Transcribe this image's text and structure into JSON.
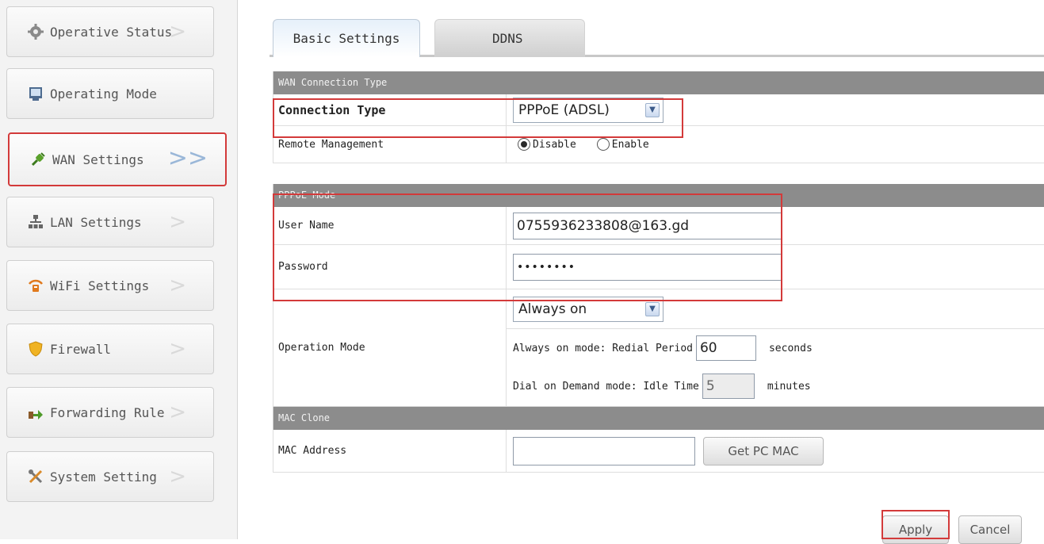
{
  "sidebar": {
    "items": [
      {
        "label": "Operative Status",
        "icon": "gear-icon",
        "active": false
      },
      {
        "label": "Operating Mode",
        "icon": "monitor-icon",
        "active": false
      },
      {
        "label": "WAN Settings",
        "icon": "plug-icon",
        "active": true
      },
      {
        "label": "LAN Settings",
        "icon": "network-icon",
        "active": false
      },
      {
        "label": "WiFi Settings",
        "icon": "wifi-router-icon",
        "active": false
      },
      {
        "label": "Firewall",
        "icon": "shield-icon",
        "active": false
      },
      {
        "label": "Forwarding Rule",
        "icon": "forward-arrow-icon",
        "active": false
      },
      {
        "label": "System Setting",
        "icon": "tools-icon",
        "active": false
      }
    ],
    "chevron": ">>"
  },
  "tabs": [
    {
      "label": "Basic Settings",
      "active": true
    },
    {
      "label": "DDNS",
      "active": false
    }
  ],
  "wan": {
    "section_title": "WAN Connection Type",
    "connection_type_label": "Connection Type",
    "connection_type_value": "PPPoE (ADSL)",
    "remote_mgmt_label": "Remote Management",
    "remote_disable": "Disable",
    "remote_enable": "Enable",
    "remote_selected": "Disable"
  },
  "pppoe": {
    "section_title": "PPPoE Mode",
    "username_label": "User Name",
    "username_value": "0755936233808@163.gd",
    "password_label": "Password",
    "password_value": "••••••••",
    "operation_mode_label": "Operation Mode",
    "operation_mode_value": "Always on",
    "redial_label": "Always on mode: Redial Period",
    "redial_value": "60",
    "redial_unit": "seconds",
    "idle_label": "Dial on Demand mode: Idle Time",
    "idle_value": "5",
    "idle_unit": "minutes"
  },
  "mac": {
    "section_title": "MAC Clone",
    "address_label": "MAC Address",
    "address_value": "",
    "get_pc_mac_label": "Get PC MAC"
  },
  "actions": {
    "apply_label": "Apply",
    "cancel_label": "Cancel"
  },
  "colors": {
    "highlight": "#d33a3a",
    "section_header": "#8c8c8c"
  }
}
